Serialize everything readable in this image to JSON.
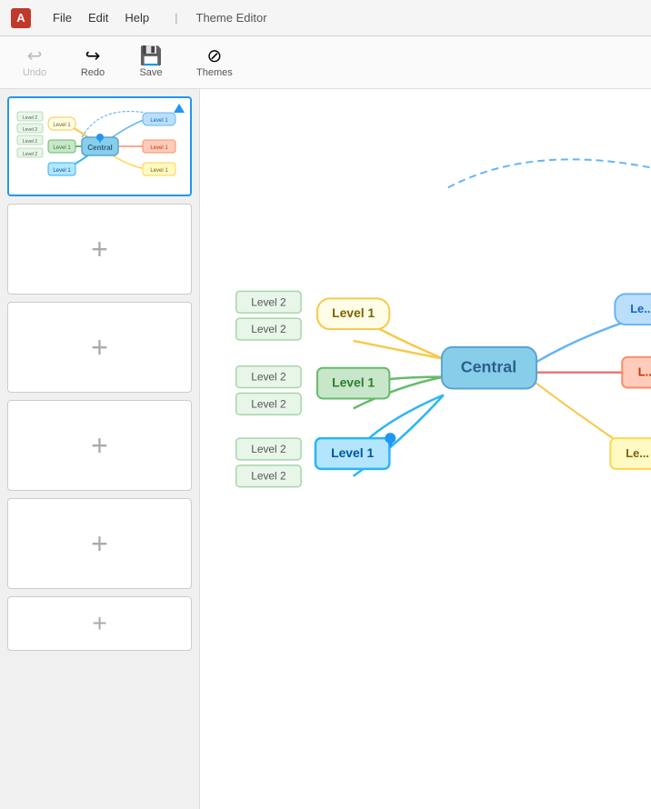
{
  "titlebar": {
    "app_name": "A",
    "menu": [
      "File",
      "Edit",
      "Help"
    ],
    "separator": "|",
    "editor_label": "Theme Editor"
  },
  "toolbar": {
    "undo_label": "Undo",
    "redo_label": "Redo",
    "save_label": "Save",
    "themes_label": "Themes"
  },
  "left_panel": {
    "add_theme_label": "+",
    "thumbnail_alt": "Theme 1"
  },
  "canvas": {
    "central_label": "Central",
    "level1_nodes": [
      "Level 1",
      "Level 1",
      "Level 1"
    ],
    "level2_nodes": [
      "Level 2",
      "Level 2",
      "Level 2",
      "Level 2",
      "Level 2",
      "Level 2"
    ],
    "right_nodes": [
      "Le...",
      "L...",
      "Le..."
    ]
  },
  "colors": {
    "selected_border": "#2196F3",
    "central_bg": "#87CEEB",
    "level1_yellow_bg": "#fffde7",
    "level1_green_bg": "#c8e6c9",
    "level1_blue_bg": "#b3e5fc"
  }
}
